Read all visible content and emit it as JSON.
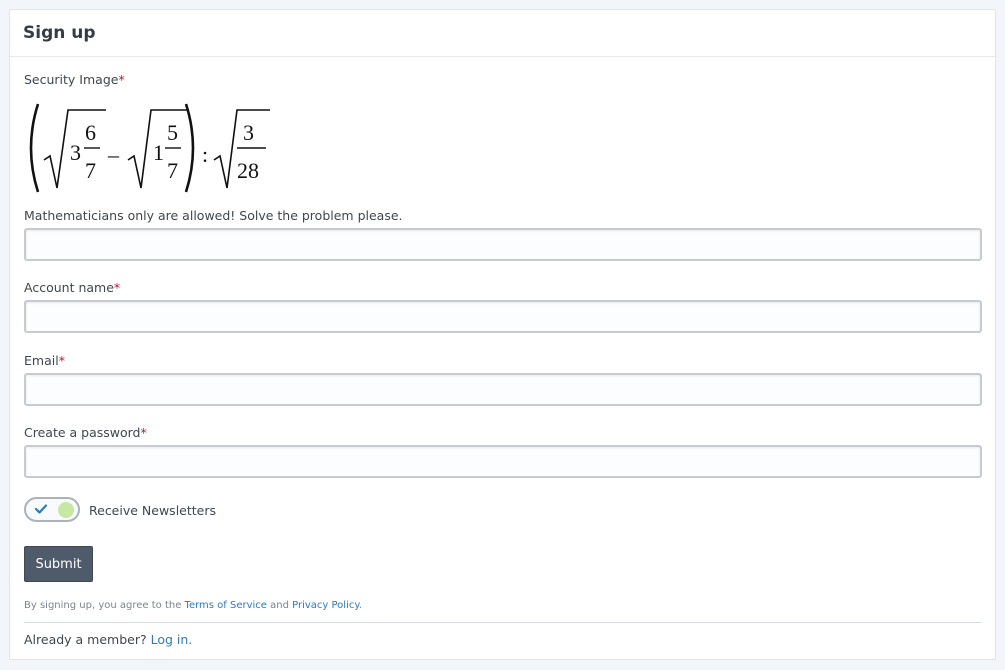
{
  "header": {
    "title": "Sign up"
  },
  "form": {
    "security_label": "Security Image",
    "required_mark": "*",
    "captcha_hint": "Mathematicians only are allowed! Solve the problem please.",
    "captcha_value": "",
    "captcha_expr": {
      "a_whole": "3",
      "a_num": "6",
      "a_den": "7",
      "minus": "–",
      "b_whole": "1",
      "b_num": "5",
      "b_den": "7",
      "colon": ":",
      "c_num": "3",
      "c_den": "28"
    },
    "account_label": "Account name",
    "account_value": "",
    "email_label": "Email",
    "email_value": "",
    "password_label": "Create a password",
    "password_value": "",
    "newsletter_label": "Receive Newsletters",
    "newsletter_checked": true,
    "submit_label": "Submit"
  },
  "footer": {
    "terms_prefix": "By signing up, you agree to the ",
    "terms_link": "Terms of Service",
    "terms_and": " and ",
    "privacy_link": "Privacy Policy",
    "terms_suffix": ".",
    "member_text": "Already a member? ",
    "login_link": "Log in."
  },
  "colors": {
    "accent": "#2a7bbf",
    "submit_bg": "#4f5b6a",
    "required": "#c8102e",
    "toggle_on": "#c6e8a2"
  }
}
